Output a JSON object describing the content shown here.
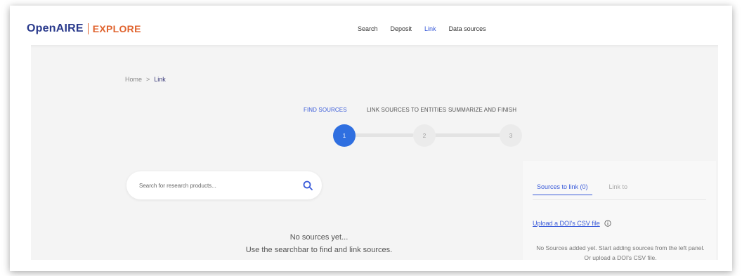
{
  "header": {
    "logo_main": "OpenAIRE",
    "logo_sub": "EXPLORE",
    "nav": [
      {
        "label": "Search",
        "active": false
      },
      {
        "label": "Deposit",
        "active": false
      },
      {
        "label": "Link",
        "active": true
      },
      {
        "label": "Data sources",
        "active": false
      }
    ]
  },
  "breadcrumb": {
    "home": "Home",
    "separator": ">",
    "current": "Link"
  },
  "stepper": {
    "steps": [
      {
        "label": "FIND SOURCES",
        "number": "1",
        "active": true
      },
      {
        "label": "LINK SOURCES TO ENTITIES",
        "number": "2",
        "active": false
      },
      {
        "label": "SUMMARIZE AND FINISH",
        "number": "3",
        "active": false
      }
    ]
  },
  "search": {
    "placeholder": "Search for research products...",
    "value": "",
    "icon": "search-icon"
  },
  "empty_state": {
    "line1": "No sources yet...",
    "line2": "Use the searchbar to find and link sources."
  },
  "panel": {
    "tabs": [
      {
        "label": "Sources to link (0)",
        "active": true
      },
      {
        "label": "Link to",
        "active": false
      }
    ],
    "upload_link": "Upload a DOI's CSV file",
    "message": "No Sources added yet. Start adding sources from the left panel. Or upload a DOI's CSV file."
  },
  "colors": {
    "brand_blue": "#2a3a8c",
    "brand_orange": "#e0632e",
    "accent": "#3a5bd9",
    "step_active": "#2f6fe0"
  }
}
